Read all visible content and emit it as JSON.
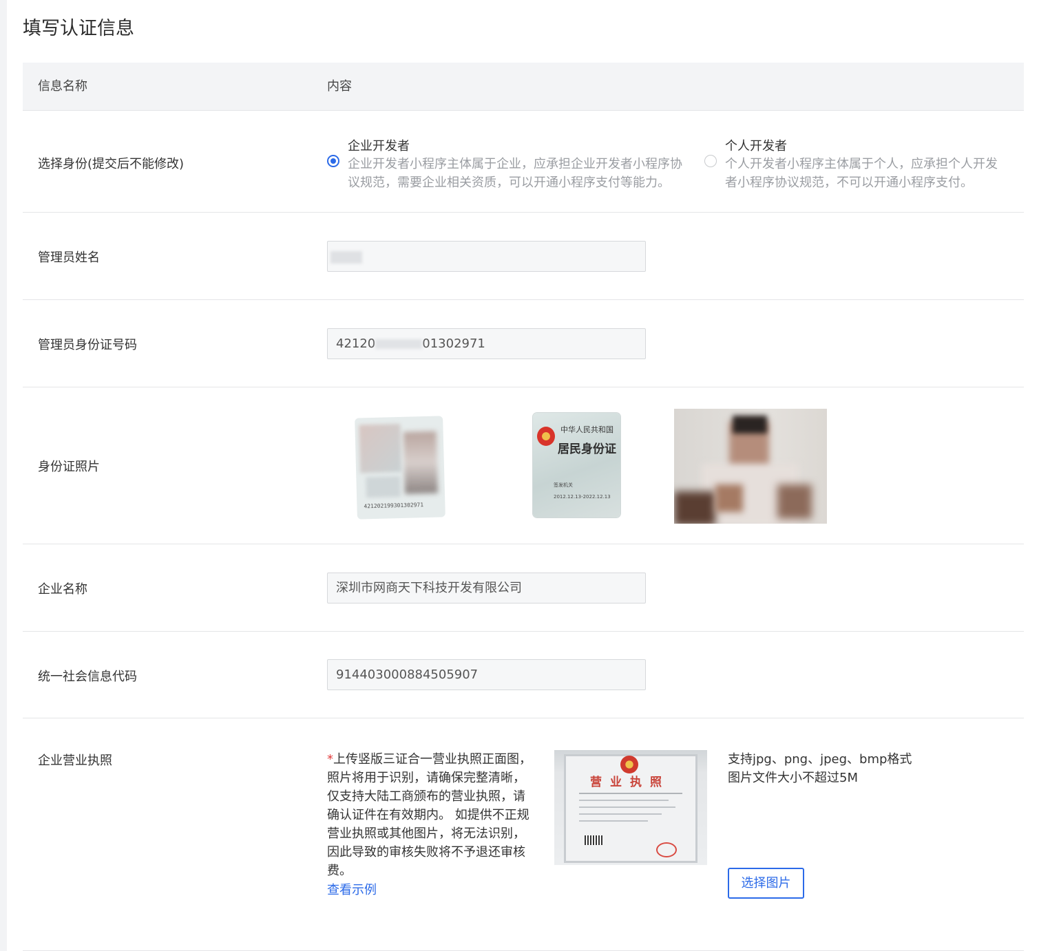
{
  "page": {
    "title": "填写认证信息"
  },
  "table_header": {
    "col_name": "信息名称",
    "col_content": "内容"
  },
  "identity": {
    "label": "选择身份(提交后不能修改)",
    "options": [
      {
        "title": "企业开发者",
        "desc": "企业开发者小程序主体属于企业，应承担企业开发者小程序协议规范，需要企业相关资质，可以开通小程序支付等能力。",
        "selected": true
      },
      {
        "title": "个人开发者",
        "desc": "个人开发者小程序主体属于个人，应承担个人开发者小程序协议规范，不可以开通小程序支付。",
        "selected": false
      }
    ]
  },
  "admin_name": {
    "label": "管理员姓名",
    "value": ""
  },
  "admin_id": {
    "label": "管理员身份证号码",
    "value_prefix": "42120",
    "value_suffix": "01302971"
  },
  "id_photos": {
    "label": "身份证照片",
    "card_back_text": "421202199301302971",
    "card_front": {
      "line1": "中华人民共和国",
      "line2": "居民身份证",
      "issuer": "签发机关",
      "validity": "2012.12.13-2022.12.13"
    }
  },
  "company_name": {
    "label": "企业名称",
    "value": "深圳市网商天下科技开发有限公司"
  },
  "credit_code": {
    "label": "统一社会信息代码",
    "value": "914403000884505907"
  },
  "license": {
    "label": "企业营业执照",
    "required_mark": "*",
    "notice": "上传竖版三证合一营业执照正面图，照片将用于识别，请确保完整清晰，仅支持大陆工商颁布的营业执照，请确认证件在有效期内。 如提供不正规营业执照或其他图片，将无法识别，因此导致的审核失败将不予退还审核费。",
    "example_link": "查看示例",
    "license_title": "营业执照",
    "formats": "支持jpg、png、jpeg、bmp格式",
    "size_limit": "图片文件大小不超过5M",
    "choose_button": "选择图片"
  },
  "colors": {
    "accent": "#2b6ae8",
    "required": "#e23c3c",
    "header_bg": "#f3f4f6"
  }
}
